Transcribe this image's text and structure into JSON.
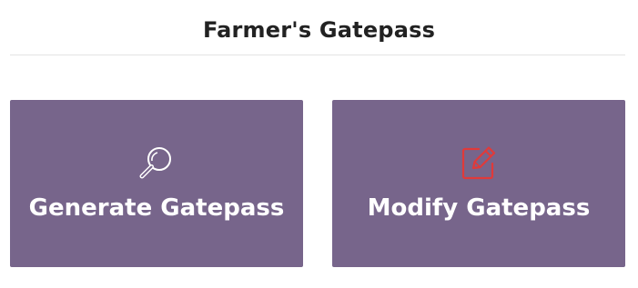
{
  "header": {
    "title": "Farmer's Gatepass"
  },
  "cards": [
    {
      "label": "Generate Gatepass",
      "icon": "search-icon",
      "icon_color": "#ffffff"
    },
    {
      "label": "Modify Gatepass",
      "icon": "edit-icon",
      "icon_color": "#e03a3a"
    }
  ],
  "colors": {
    "card_background": "#77658b",
    "title_text": "#222222",
    "card_text": "#ffffff"
  }
}
